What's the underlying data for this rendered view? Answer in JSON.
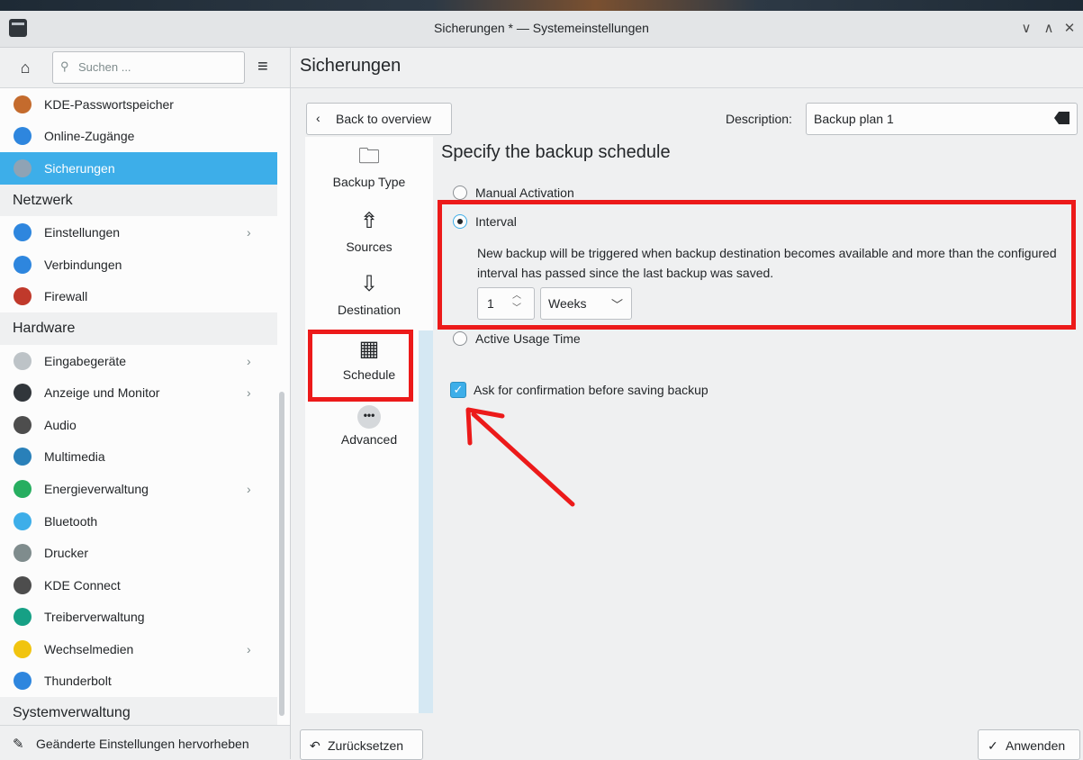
{
  "window": {
    "title": "Sicherungen * — Systemeinstellungen",
    "controls": [
      "∨",
      "∧",
      "✕"
    ]
  },
  "sidebar": {
    "search_placeholder": "Suchen ...",
    "items": [
      {
        "type": "item",
        "label": "KDE-Passwortspeicher",
        "icon": "kwallet-icon",
        "color": "#c46b2d",
        "chevron": false
      },
      {
        "type": "item",
        "label": "Online-Zugänge",
        "icon": "globe-icon",
        "color": "#2e86de",
        "chevron": false
      },
      {
        "type": "item",
        "label": "Sicherungen",
        "icon": "backup-icon",
        "color": "#8fa3b5",
        "chevron": false,
        "selected": true
      },
      {
        "type": "category",
        "label": "Netzwerk"
      },
      {
        "type": "item",
        "label": "Einstellungen",
        "icon": "globe-icon",
        "color": "#2e86de",
        "chevron": true
      },
      {
        "type": "item",
        "label": "Verbindungen",
        "icon": "globe-icon",
        "color": "#2e86de",
        "chevron": false
      },
      {
        "type": "item",
        "label": "Firewall",
        "icon": "firewall-icon",
        "color": "#c0392b",
        "chevron": false
      },
      {
        "type": "category",
        "label": "Hardware"
      },
      {
        "type": "item",
        "label": "Eingabegeräte",
        "icon": "mouse-icon",
        "color": "#bdc3c7",
        "chevron": true
      },
      {
        "type": "item",
        "label": "Anzeige und Monitor",
        "icon": "monitor-icon",
        "color": "#31363b",
        "chevron": true
      },
      {
        "type": "item",
        "label": "Audio",
        "icon": "speaker-icon",
        "color": "#4d4d4d",
        "chevron": false
      },
      {
        "type": "item",
        "label": "Multimedia",
        "icon": "multimedia-icon",
        "color": "#2980b9",
        "chevron": false
      },
      {
        "type": "item",
        "label": "Energieverwaltung",
        "icon": "power-icon",
        "color": "#27ae60",
        "chevron": true
      },
      {
        "type": "item",
        "label": "Bluetooth",
        "icon": "bluetooth-icon",
        "color": "#3daee9",
        "chevron": false
      },
      {
        "type": "item",
        "label": "Drucker",
        "icon": "printer-icon",
        "color": "#7f8c8d",
        "chevron": false
      },
      {
        "type": "item",
        "label": "KDE Connect",
        "icon": "phone-icon",
        "color": "#4d4d4d",
        "chevron": false
      },
      {
        "type": "item",
        "label": "Treiberverwaltung",
        "icon": "driver-icon",
        "color": "#16a085",
        "chevron": false
      },
      {
        "type": "item",
        "label": "Wechselmedien",
        "icon": "usb-icon",
        "color": "#f1c40f",
        "chevron": true
      },
      {
        "type": "item",
        "label": "Thunderbolt",
        "icon": "thunderbolt-icon",
        "color": "#2e86de",
        "chevron": false
      },
      {
        "type": "category",
        "label": "Systemverwaltung"
      }
    ],
    "highlight_label": "Geänderte Einstellungen hervorheben"
  },
  "main": {
    "title": "Sicherungen",
    "back_label": "Back to overview",
    "description_label": "Description:",
    "description_value": "Backup plan 1",
    "steps": [
      {
        "label": "Backup Type",
        "glyph": "🗀"
      },
      {
        "label": "Sources",
        "glyph": "⇮"
      },
      {
        "label": "Destination",
        "glyph": "⇩"
      },
      {
        "label": "Schedule",
        "glyph": "▦"
      },
      {
        "label": "Advanced",
        "glyph": "•••"
      }
    ],
    "schedule_title": "Specify the backup schedule",
    "manual_label": "Manual Activation",
    "interval_label": "Interval",
    "interval_help": "New backup will be triggered when backup destination becomes available and more than the configured interval has passed since the last backup was saved.",
    "interval_value": "1",
    "interval_unit": "Weeks",
    "usage_label": "Active Usage Time",
    "confirm_label": "Ask for confirmation before saving backup",
    "confirm_checked": true,
    "reset_label": "Zurücksetzen",
    "apply_label": "Anwenden"
  },
  "colors": {
    "accent": "#3daee9",
    "annotation": "#ec1a1a"
  }
}
